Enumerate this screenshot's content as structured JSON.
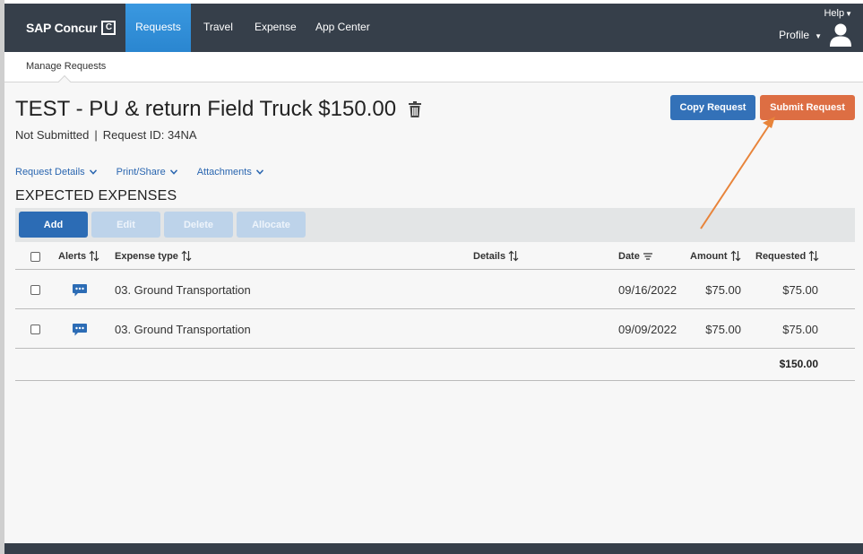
{
  "nav": {
    "brand": "SAP Concur",
    "brand_mark": "C",
    "items": [
      {
        "label": "Requests"
      },
      {
        "label": "Travel"
      },
      {
        "label": "Expense"
      },
      {
        "label": "App Center"
      }
    ],
    "help": "Help",
    "profile": "Profile"
  },
  "subnav": {
    "item": "Manage Requests"
  },
  "request": {
    "title": "TEST - PU & return Field Truck $150.00",
    "status": "Not Submitted",
    "separator": "|",
    "request_id": "Request ID: 34NA"
  },
  "actions": {
    "copy": "Copy Request",
    "submit": "Submit Request"
  },
  "links": [
    "Request Details",
    "Print/Share",
    "Attachments"
  ],
  "section_title": "EXPECTED EXPENSES",
  "toolbar": {
    "add": "Add",
    "edit": "Edit",
    "delete": "Delete",
    "allocate": "Allocate"
  },
  "table": {
    "headers": {
      "alerts": "Alerts",
      "expense_type": "Expense type",
      "details": "Details",
      "date": "Date",
      "amount": "Amount",
      "requested": "Requested"
    },
    "rows": [
      {
        "expense_type": "03. Ground Transportation",
        "date": "09/16/2022",
        "amount": "$75.00",
        "requested": "$75.00"
      },
      {
        "expense_type": "03. Ground Transportation",
        "date": "09/09/2022",
        "amount": "$75.00",
        "requested": "$75.00"
      }
    ],
    "total": "$150.00"
  },
  "colors": {
    "nav_bg": "#363f4a",
    "nav_active": "#2f8ed9",
    "primary": "#3371b8",
    "submit": "#dd6e43",
    "annotation_arrow": "#e8843a"
  },
  "icons": [
    "trash-icon",
    "chevron-down-icon",
    "sort-icon",
    "filter-lines-icon",
    "chat-bubble-icon",
    "avatar-icon"
  ]
}
